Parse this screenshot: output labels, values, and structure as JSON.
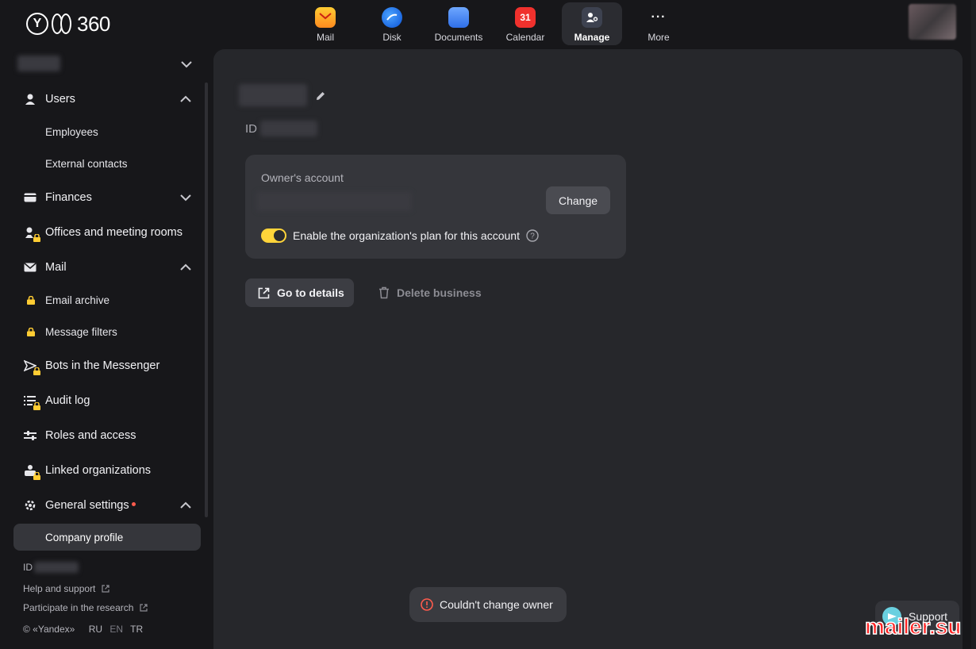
{
  "header": {
    "logo_text": "360",
    "apps": [
      {
        "label": "Mail"
      },
      {
        "label": "Disk"
      },
      {
        "label": "Documents"
      },
      {
        "label": "Calendar",
        "badge": "31"
      },
      {
        "label": "Manage"
      },
      {
        "label": "More"
      }
    ]
  },
  "sidebar": {
    "users": "Users",
    "employees": "Employees",
    "external_contacts": "External contacts",
    "finances": "Finances",
    "offices": "Offices and meeting rooms",
    "mail": "Mail",
    "email_archive": "Email archive",
    "message_filters": "Message filters",
    "bots": "Bots in the Messenger",
    "audit_log": "Audit log",
    "roles": "Roles and access",
    "linked_orgs": "Linked organizations",
    "general_settings": "General settings",
    "company_profile": "Company profile",
    "footer": {
      "id_label": "ID",
      "help": "Help and support",
      "research": "Participate in the research",
      "copyright": "© «Yandex»",
      "langs": [
        "RU",
        "EN",
        "TR"
      ]
    }
  },
  "main": {
    "id_label": "ID",
    "owner_card": {
      "title": "Owner's account",
      "change_label": "Change",
      "toggle_label": "Enable the organization's plan for this account",
      "toggle_on": true
    },
    "go_to_details": "Go to details",
    "delete_business": "Delete business"
  },
  "toast": {
    "message": "Couldn't change owner"
  },
  "support": {
    "label": "Support"
  },
  "watermark": "mailer.su",
  "colors": {
    "accent_toggle": "#ffd43a",
    "error": "#ff5b4d",
    "background": "#17171a",
    "panel": "#26272b"
  }
}
